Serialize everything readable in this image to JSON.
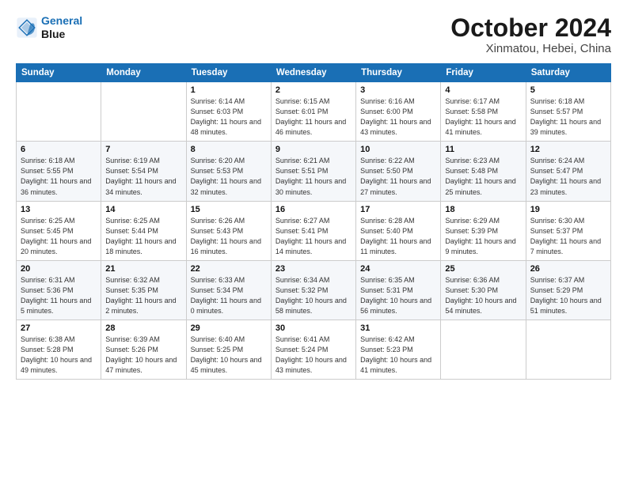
{
  "logo": {
    "line1": "General",
    "line2": "Blue"
  },
  "title": "October 2024",
  "subtitle": "Xinmatou, Hebei, China",
  "weekdays": [
    "Sunday",
    "Monday",
    "Tuesday",
    "Wednesday",
    "Thursday",
    "Friday",
    "Saturday"
  ],
  "weeks": [
    [
      {
        "day": "",
        "info": ""
      },
      {
        "day": "",
        "info": ""
      },
      {
        "day": "1",
        "info": "Sunrise: 6:14 AM\nSunset: 6:03 PM\nDaylight: 11 hours and 48 minutes."
      },
      {
        "day": "2",
        "info": "Sunrise: 6:15 AM\nSunset: 6:01 PM\nDaylight: 11 hours and 46 minutes."
      },
      {
        "day": "3",
        "info": "Sunrise: 6:16 AM\nSunset: 6:00 PM\nDaylight: 11 hours and 43 minutes."
      },
      {
        "day": "4",
        "info": "Sunrise: 6:17 AM\nSunset: 5:58 PM\nDaylight: 11 hours and 41 minutes."
      },
      {
        "day": "5",
        "info": "Sunrise: 6:18 AM\nSunset: 5:57 PM\nDaylight: 11 hours and 39 minutes."
      }
    ],
    [
      {
        "day": "6",
        "info": "Sunrise: 6:18 AM\nSunset: 5:55 PM\nDaylight: 11 hours and 36 minutes."
      },
      {
        "day": "7",
        "info": "Sunrise: 6:19 AM\nSunset: 5:54 PM\nDaylight: 11 hours and 34 minutes."
      },
      {
        "day": "8",
        "info": "Sunrise: 6:20 AM\nSunset: 5:53 PM\nDaylight: 11 hours and 32 minutes."
      },
      {
        "day": "9",
        "info": "Sunrise: 6:21 AM\nSunset: 5:51 PM\nDaylight: 11 hours and 30 minutes."
      },
      {
        "day": "10",
        "info": "Sunrise: 6:22 AM\nSunset: 5:50 PM\nDaylight: 11 hours and 27 minutes."
      },
      {
        "day": "11",
        "info": "Sunrise: 6:23 AM\nSunset: 5:48 PM\nDaylight: 11 hours and 25 minutes."
      },
      {
        "day": "12",
        "info": "Sunrise: 6:24 AM\nSunset: 5:47 PM\nDaylight: 11 hours and 23 minutes."
      }
    ],
    [
      {
        "day": "13",
        "info": "Sunrise: 6:25 AM\nSunset: 5:45 PM\nDaylight: 11 hours and 20 minutes."
      },
      {
        "day": "14",
        "info": "Sunrise: 6:25 AM\nSunset: 5:44 PM\nDaylight: 11 hours and 18 minutes."
      },
      {
        "day": "15",
        "info": "Sunrise: 6:26 AM\nSunset: 5:43 PM\nDaylight: 11 hours and 16 minutes."
      },
      {
        "day": "16",
        "info": "Sunrise: 6:27 AM\nSunset: 5:41 PM\nDaylight: 11 hours and 14 minutes."
      },
      {
        "day": "17",
        "info": "Sunrise: 6:28 AM\nSunset: 5:40 PM\nDaylight: 11 hours and 11 minutes."
      },
      {
        "day": "18",
        "info": "Sunrise: 6:29 AM\nSunset: 5:39 PM\nDaylight: 11 hours and 9 minutes."
      },
      {
        "day": "19",
        "info": "Sunrise: 6:30 AM\nSunset: 5:37 PM\nDaylight: 11 hours and 7 minutes."
      }
    ],
    [
      {
        "day": "20",
        "info": "Sunrise: 6:31 AM\nSunset: 5:36 PM\nDaylight: 11 hours and 5 minutes."
      },
      {
        "day": "21",
        "info": "Sunrise: 6:32 AM\nSunset: 5:35 PM\nDaylight: 11 hours and 2 minutes."
      },
      {
        "day": "22",
        "info": "Sunrise: 6:33 AM\nSunset: 5:34 PM\nDaylight: 11 hours and 0 minutes."
      },
      {
        "day": "23",
        "info": "Sunrise: 6:34 AM\nSunset: 5:32 PM\nDaylight: 10 hours and 58 minutes."
      },
      {
        "day": "24",
        "info": "Sunrise: 6:35 AM\nSunset: 5:31 PM\nDaylight: 10 hours and 56 minutes."
      },
      {
        "day": "25",
        "info": "Sunrise: 6:36 AM\nSunset: 5:30 PM\nDaylight: 10 hours and 54 minutes."
      },
      {
        "day": "26",
        "info": "Sunrise: 6:37 AM\nSunset: 5:29 PM\nDaylight: 10 hours and 51 minutes."
      }
    ],
    [
      {
        "day": "27",
        "info": "Sunrise: 6:38 AM\nSunset: 5:28 PM\nDaylight: 10 hours and 49 minutes."
      },
      {
        "day": "28",
        "info": "Sunrise: 6:39 AM\nSunset: 5:26 PM\nDaylight: 10 hours and 47 minutes."
      },
      {
        "day": "29",
        "info": "Sunrise: 6:40 AM\nSunset: 5:25 PM\nDaylight: 10 hours and 45 minutes."
      },
      {
        "day": "30",
        "info": "Sunrise: 6:41 AM\nSunset: 5:24 PM\nDaylight: 10 hours and 43 minutes."
      },
      {
        "day": "31",
        "info": "Sunrise: 6:42 AM\nSunset: 5:23 PM\nDaylight: 10 hours and 41 minutes."
      },
      {
        "day": "",
        "info": ""
      },
      {
        "day": "",
        "info": ""
      }
    ]
  ]
}
